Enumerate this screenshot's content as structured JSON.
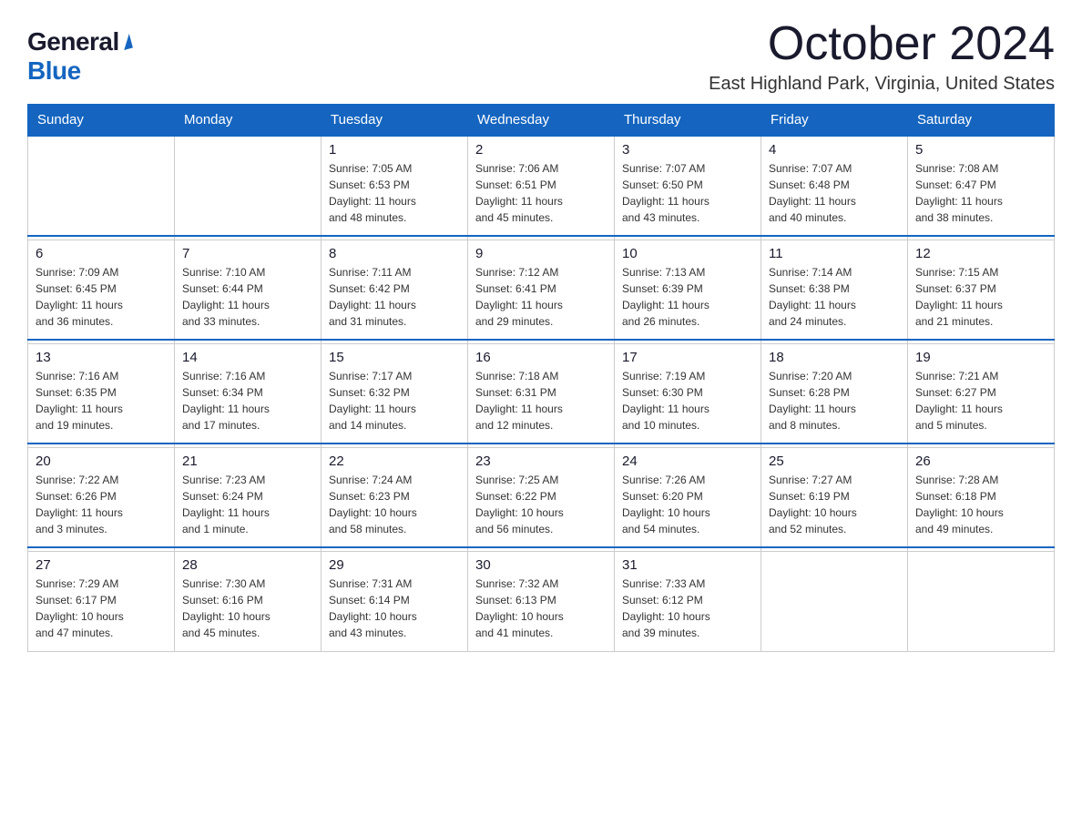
{
  "header": {
    "logo_general": "General",
    "logo_blue": "Blue",
    "month_title": "October 2024",
    "location": "East Highland Park, Virginia, United States"
  },
  "days_of_week": [
    "Sunday",
    "Monday",
    "Tuesday",
    "Wednesday",
    "Thursday",
    "Friday",
    "Saturday"
  ],
  "weeks": [
    [
      {
        "day": "",
        "info": ""
      },
      {
        "day": "",
        "info": ""
      },
      {
        "day": "1",
        "info": "Sunrise: 7:05 AM\nSunset: 6:53 PM\nDaylight: 11 hours\nand 48 minutes."
      },
      {
        "day": "2",
        "info": "Sunrise: 7:06 AM\nSunset: 6:51 PM\nDaylight: 11 hours\nand 45 minutes."
      },
      {
        "day": "3",
        "info": "Sunrise: 7:07 AM\nSunset: 6:50 PM\nDaylight: 11 hours\nand 43 minutes."
      },
      {
        "day": "4",
        "info": "Sunrise: 7:07 AM\nSunset: 6:48 PM\nDaylight: 11 hours\nand 40 minutes."
      },
      {
        "day": "5",
        "info": "Sunrise: 7:08 AM\nSunset: 6:47 PM\nDaylight: 11 hours\nand 38 minutes."
      }
    ],
    [
      {
        "day": "6",
        "info": "Sunrise: 7:09 AM\nSunset: 6:45 PM\nDaylight: 11 hours\nand 36 minutes."
      },
      {
        "day": "7",
        "info": "Sunrise: 7:10 AM\nSunset: 6:44 PM\nDaylight: 11 hours\nand 33 minutes."
      },
      {
        "day": "8",
        "info": "Sunrise: 7:11 AM\nSunset: 6:42 PM\nDaylight: 11 hours\nand 31 minutes."
      },
      {
        "day": "9",
        "info": "Sunrise: 7:12 AM\nSunset: 6:41 PM\nDaylight: 11 hours\nand 29 minutes."
      },
      {
        "day": "10",
        "info": "Sunrise: 7:13 AM\nSunset: 6:39 PM\nDaylight: 11 hours\nand 26 minutes."
      },
      {
        "day": "11",
        "info": "Sunrise: 7:14 AM\nSunset: 6:38 PM\nDaylight: 11 hours\nand 24 minutes."
      },
      {
        "day": "12",
        "info": "Sunrise: 7:15 AM\nSunset: 6:37 PM\nDaylight: 11 hours\nand 21 minutes."
      }
    ],
    [
      {
        "day": "13",
        "info": "Sunrise: 7:16 AM\nSunset: 6:35 PM\nDaylight: 11 hours\nand 19 minutes."
      },
      {
        "day": "14",
        "info": "Sunrise: 7:16 AM\nSunset: 6:34 PM\nDaylight: 11 hours\nand 17 minutes."
      },
      {
        "day": "15",
        "info": "Sunrise: 7:17 AM\nSunset: 6:32 PM\nDaylight: 11 hours\nand 14 minutes."
      },
      {
        "day": "16",
        "info": "Sunrise: 7:18 AM\nSunset: 6:31 PM\nDaylight: 11 hours\nand 12 minutes."
      },
      {
        "day": "17",
        "info": "Sunrise: 7:19 AM\nSunset: 6:30 PM\nDaylight: 11 hours\nand 10 minutes."
      },
      {
        "day": "18",
        "info": "Sunrise: 7:20 AM\nSunset: 6:28 PM\nDaylight: 11 hours\nand 8 minutes."
      },
      {
        "day": "19",
        "info": "Sunrise: 7:21 AM\nSunset: 6:27 PM\nDaylight: 11 hours\nand 5 minutes."
      }
    ],
    [
      {
        "day": "20",
        "info": "Sunrise: 7:22 AM\nSunset: 6:26 PM\nDaylight: 11 hours\nand 3 minutes."
      },
      {
        "day": "21",
        "info": "Sunrise: 7:23 AM\nSunset: 6:24 PM\nDaylight: 11 hours\nand 1 minute."
      },
      {
        "day": "22",
        "info": "Sunrise: 7:24 AM\nSunset: 6:23 PM\nDaylight: 10 hours\nand 58 minutes."
      },
      {
        "day": "23",
        "info": "Sunrise: 7:25 AM\nSunset: 6:22 PM\nDaylight: 10 hours\nand 56 minutes."
      },
      {
        "day": "24",
        "info": "Sunrise: 7:26 AM\nSunset: 6:20 PM\nDaylight: 10 hours\nand 54 minutes."
      },
      {
        "day": "25",
        "info": "Sunrise: 7:27 AM\nSunset: 6:19 PM\nDaylight: 10 hours\nand 52 minutes."
      },
      {
        "day": "26",
        "info": "Sunrise: 7:28 AM\nSunset: 6:18 PM\nDaylight: 10 hours\nand 49 minutes."
      }
    ],
    [
      {
        "day": "27",
        "info": "Sunrise: 7:29 AM\nSunset: 6:17 PM\nDaylight: 10 hours\nand 47 minutes."
      },
      {
        "day": "28",
        "info": "Sunrise: 7:30 AM\nSunset: 6:16 PM\nDaylight: 10 hours\nand 45 minutes."
      },
      {
        "day": "29",
        "info": "Sunrise: 7:31 AM\nSunset: 6:14 PM\nDaylight: 10 hours\nand 43 minutes."
      },
      {
        "day": "30",
        "info": "Sunrise: 7:32 AM\nSunset: 6:13 PM\nDaylight: 10 hours\nand 41 minutes."
      },
      {
        "day": "31",
        "info": "Sunrise: 7:33 AM\nSunset: 6:12 PM\nDaylight: 10 hours\nand 39 minutes."
      },
      {
        "day": "",
        "info": ""
      },
      {
        "day": "",
        "info": ""
      }
    ]
  ]
}
